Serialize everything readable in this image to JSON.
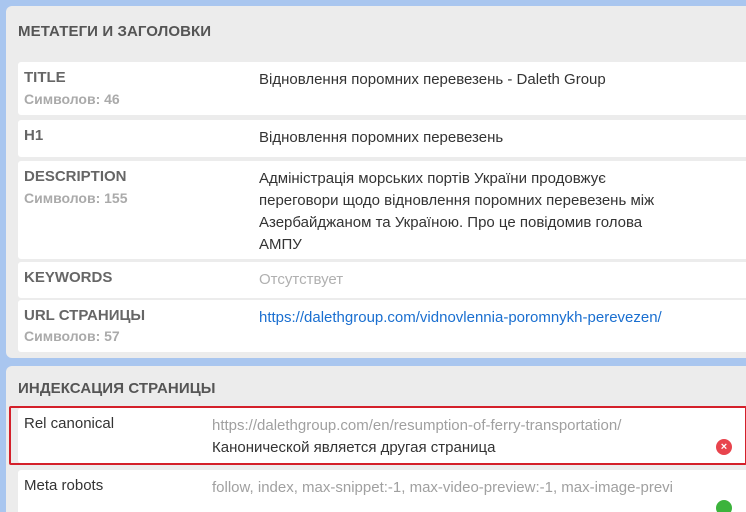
{
  "meta_section": {
    "title": "МЕТАТЕГИ И ЗАГОЛОВКИ",
    "rows": [
      {
        "label": "TITLE",
        "sub": "Символов: 46",
        "value": "Відновлення поромних перевезень - Daleth Group"
      },
      {
        "label": "H1",
        "value": "Відновлення поромних перевезень"
      },
      {
        "label": "DESCRIPTION",
        "sub": "Символов: 155",
        "value": "Адміністрація морських портів України продовжує переговори щодо відновлення поромних перевезень між Азербайджаном та Україною. Про це повідомив голова АМПУ"
      },
      {
        "label": "KEYWORDS",
        "value": "Отсутствует"
      },
      {
        "label": "URL СТРАНИЦЫ",
        "sub": "Символов: 57",
        "value": "https://dalethgroup.com/vidnovlennia-poromnykh-perevezen/"
      }
    ]
  },
  "index_section": {
    "title": "ИНДЕКСАЦИЯ СТРАНИЦЫ",
    "rows": [
      {
        "label": "Rel canonical",
        "value": "https://dalethgroup.com/en/resumption-of-ferry-transportation/",
        "note": "Канонической является другая страница",
        "status": "error",
        "status_glyph": "×"
      },
      {
        "label": "Meta robots",
        "value": "follow, index, max-snippet:-1, max-video-preview:-1, max-image-previ",
        "status": "ok"
      }
    ]
  },
  "colors": {
    "background": "#a9c6ef",
    "panel": "#ececec",
    "link": "#1a6fd0",
    "highlight_border": "#d4202a",
    "error": "#e8444d",
    "ok": "#3cb33c"
  }
}
